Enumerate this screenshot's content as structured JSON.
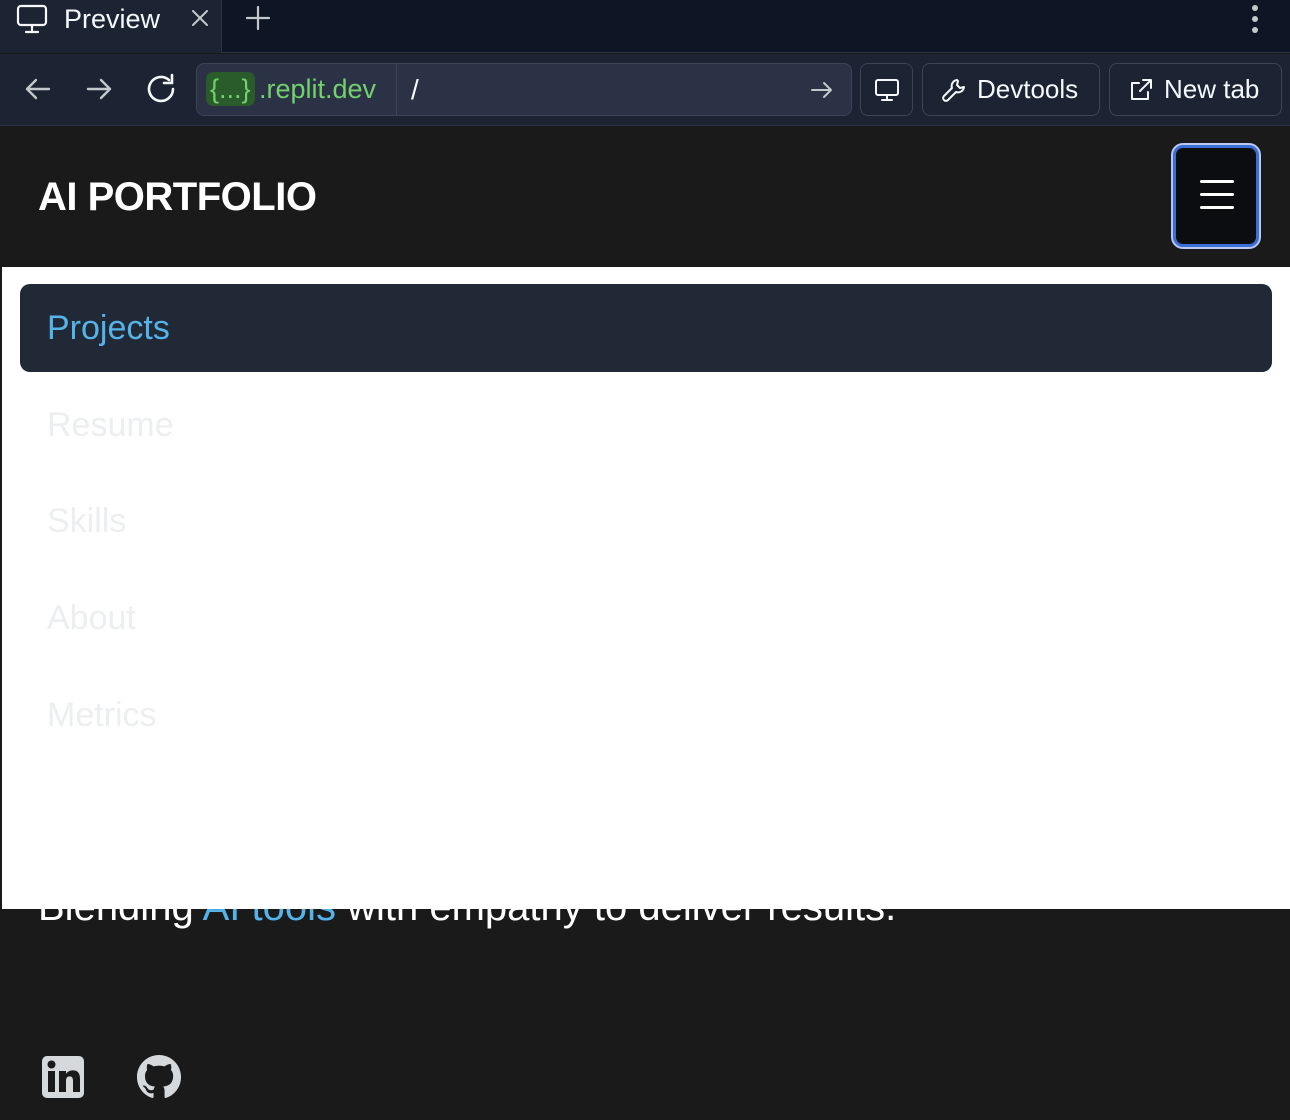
{
  "browser": {
    "tab": {
      "title": "Preview",
      "icon": "monitor-icon"
    },
    "address": {
      "host_chip": "{...}",
      "domain": ".replit.dev",
      "path": "/"
    },
    "toolbar": {
      "devtools_label": "Devtools",
      "newtab_label": "New tab"
    },
    "colors": {
      "chrome": "#1c2333",
      "url_green": "#73d16d"
    }
  },
  "site": {
    "logo": "AI PORTFOLIO",
    "menu": {
      "items": [
        {
          "label": "Projects",
          "active": true
        },
        {
          "label": "Resume",
          "active": false
        },
        {
          "label": "Skills",
          "active": false
        },
        {
          "label": "About",
          "active": false
        },
        {
          "label": "Metrics",
          "active": false
        }
      ]
    },
    "hero": {
      "tagline_before": "Blending ",
      "tagline_highlight": "AI tools",
      "tagline_after": " with empathy to deliver results."
    },
    "social": [
      "linkedin-icon",
      "github-icon"
    ],
    "colors": {
      "accent": "#55b3e8",
      "background": "#1a1a1b"
    }
  }
}
